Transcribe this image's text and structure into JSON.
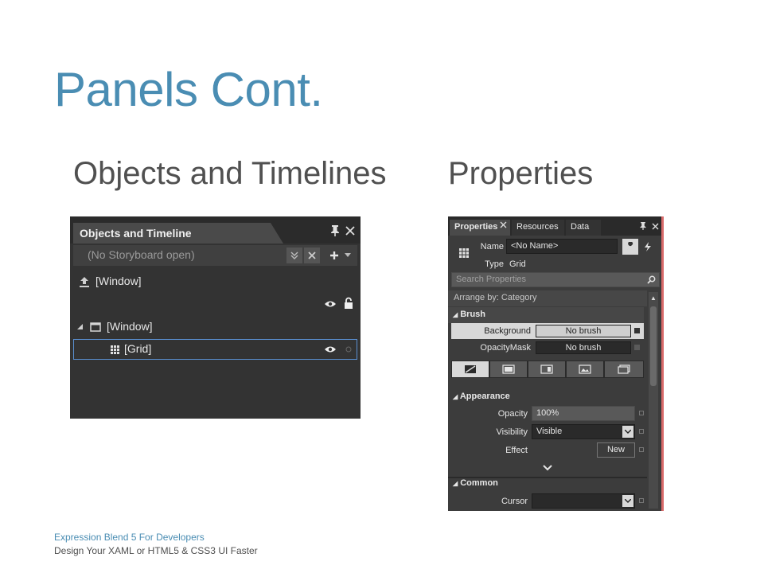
{
  "slide": {
    "title": "Panels Cont.",
    "left_heading": "Objects and Timelines",
    "right_heading": "Properties",
    "footer_line1": "Expression Blend 5 For Developers",
    "footer_line2": "Design Your XAML or HTML5 & CSS3 UI Faster"
  },
  "objects_panel": {
    "tab_label": "Objects and Timeline",
    "storyboard_placeholder": "(No Storyboard open)",
    "tree": [
      {
        "label": "[Window]",
        "icon": "upload-icon"
      },
      {
        "label": "[Window]",
        "icon": "window-icon"
      },
      {
        "label": "[Grid]",
        "icon": "grid-icon"
      }
    ],
    "colors": {
      "background": "#333333",
      "selection": "#5a8fd0"
    }
  },
  "properties_panel": {
    "tabs": [
      "Properties",
      "Resources",
      "Data"
    ],
    "name_label": "Name",
    "name_value": "<No Name>",
    "type_label": "Type",
    "type_value": "Grid",
    "search_placeholder": "Search Properties",
    "arrange_by": "Arrange by: Category",
    "brush_section": "Brush",
    "brush_rows": [
      {
        "label": "Background",
        "value": "No brush"
      },
      {
        "label": "OpacityMask",
        "value": "No brush"
      }
    ],
    "appearance_section": "Appearance",
    "opacity_label": "Opacity",
    "opacity_value": "100%",
    "visibility_label": "Visibility",
    "visibility_value": "Visible",
    "effect_label": "Effect",
    "effect_button": "New",
    "common_section": "Common",
    "cursor_label": "Cursor",
    "cursor_value": "",
    "colors": {
      "background": "#3c3c3c",
      "accent": "#d86a6a"
    }
  }
}
